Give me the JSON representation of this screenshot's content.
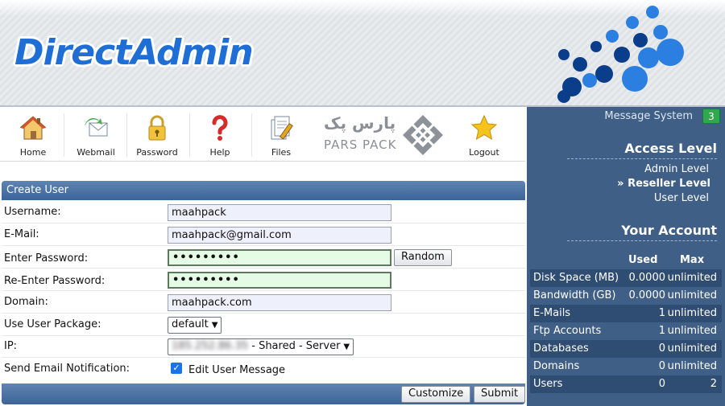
{
  "brand": {
    "logo_text": "DirectAdmin",
    "partner_fa": "پارس پک",
    "partner_en": "PARS PACK"
  },
  "toolbar": {
    "items": [
      {
        "label": "Home",
        "icon": "house-icon"
      },
      {
        "label": "Webmail",
        "icon": "mail-icon"
      },
      {
        "label": "Password",
        "icon": "padlock-icon"
      },
      {
        "label": "Help",
        "icon": "question-icon"
      },
      {
        "label": "Files",
        "icon": "files-icon"
      },
      {
        "label": "Logout",
        "icon": "star-icon"
      }
    ]
  },
  "form": {
    "title": "Create User",
    "username_label": "Username:",
    "username_value": "maahpack",
    "email_label": "E-Mail:",
    "email_value": "maahpack@gmail.com",
    "password_label": "Enter Password:",
    "password_mask": "•••••••••",
    "random_button": "Random",
    "repassword_label": "Re-Enter Password:",
    "repassword_mask": "•••••••••",
    "domain_label": "Domain:",
    "domain_value": "maahpack.com",
    "package_label": "Use User Package:",
    "package_value": "default",
    "ip_label": "IP:",
    "ip_value": "185.252.86.35",
    "ip_suffix": " - Shared - Server",
    "notify_label": "Send Email Notification:",
    "notify_checked": true,
    "notify_option": "Edit User Message",
    "customize_button": "Customize",
    "submit_button": "Submit"
  },
  "sidebar": {
    "message_system": "Message System",
    "message_count": "3",
    "access_level_title": "Access Level",
    "levels": [
      {
        "label": "Admin Level",
        "active": false
      },
      {
        "label": "» Reseller Level",
        "active": true
      },
      {
        "label": "User Level",
        "active": false
      }
    ],
    "account_title": "Your Account",
    "col_used": "Used",
    "col_max": "Max",
    "rows": [
      {
        "name": "Disk Space (MB)",
        "used": "0.0000",
        "max": "unlimited"
      },
      {
        "name": "Bandwidth (GB)",
        "used": "0.0000",
        "max": "unlimited"
      },
      {
        "name": "E-Mails",
        "used": "1",
        "max": "unlimited"
      },
      {
        "name": "Ftp Accounts",
        "used": "1",
        "max": "unlimited"
      },
      {
        "name": "Databases",
        "used": "0",
        "max": "unlimited"
      },
      {
        "name": "Domains",
        "used": "0",
        "max": "unlimited"
      },
      {
        "name": "Users",
        "used": "0",
        "max": "2"
      }
    ]
  },
  "colors": {
    "brand_blue": "#1f6ed6",
    "sidebar_bg": "#3f5f87",
    "panel_bar": "#4a70a2",
    "badge_green": "#2fa84f"
  }
}
